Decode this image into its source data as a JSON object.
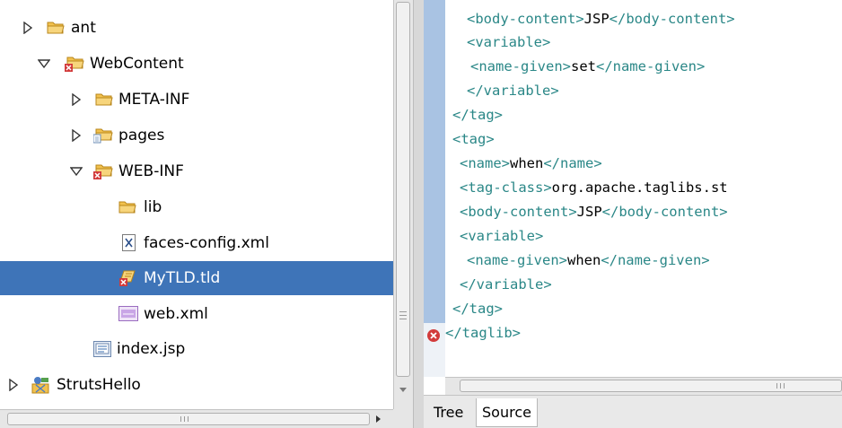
{
  "tree": {
    "items": [
      {
        "label": "ant",
        "icon": "folder-icon",
        "twisty": "collapsed"
      },
      {
        "label": "WebContent",
        "icon": "folder-error-icon",
        "twisty": "expanded"
      },
      {
        "label": "META-INF",
        "icon": "folder-icon",
        "twisty": "collapsed"
      },
      {
        "label": "pages",
        "icon": "folder-pages-icon",
        "twisty": "collapsed"
      },
      {
        "label": "WEB-INF",
        "icon": "folder-error-icon",
        "twisty": "expanded"
      },
      {
        "label": "lib",
        "icon": "folder-icon",
        "twisty": "none"
      },
      {
        "label": "faces-config.xml",
        "icon": "xml-file-icon",
        "twisty": "none"
      },
      {
        "label": "MyTLD.tld",
        "icon": "tld-error-icon",
        "twisty": "none",
        "selected": true
      },
      {
        "label": "web.xml",
        "icon": "web-xml-icon",
        "twisty": "none"
      },
      {
        "label": "index.jsp",
        "icon": "jsp-file-icon",
        "twisty": "none"
      },
      {
        "label": "StrutsHello",
        "icon": "project-icon",
        "twisty": "collapsed"
      }
    ]
  },
  "editor": {
    "code_lines": [
      {
        "open": "<body-content>",
        "text": "JSP",
        "close": "</body-content>"
      },
      {
        "open": "<variable>",
        "text": "",
        "close": ""
      },
      {
        "open": "<name-given>",
        "text": "set",
        "close": "</name-given>"
      },
      {
        "open": "</variable>",
        "text": "",
        "close": ""
      },
      {
        "open": "</tag>",
        "text": "",
        "close": ""
      },
      {
        "open": "<tag>",
        "text": "",
        "close": ""
      },
      {
        "open": "<name>",
        "text": "when",
        "close": "</name>"
      },
      {
        "open": "<tag-class>",
        "text": "org.apache.taglibs.st",
        "close": ""
      },
      {
        "open": "<body-content>",
        "text": "JSP",
        "close": "</body-content>"
      },
      {
        "open": "<variable>",
        "text": "",
        "close": ""
      },
      {
        "open": "<name-given>",
        "text": "when",
        "close": "</name-given>"
      },
      {
        "open": "</variable>",
        "text": "",
        "close": ""
      },
      {
        "open": "</tag>",
        "text": "",
        "close": ""
      },
      {
        "open": "</taglib>",
        "text": "",
        "close": ""
      }
    ],
    "tabs": [
      {
        "label": "Tree",
        "active": false
      },
      {
        "label": "Source",
        "active": true
      }
    ],
    "error_marker": "error-icon"
  },
  "colors": {
    "selection": "#3e74b8",
    "tag": "#2a8787",
    "gutter": "#a9c3e3",
    "folder": "#f2c14e",
    "error": "#d23b3b"
  }
}
